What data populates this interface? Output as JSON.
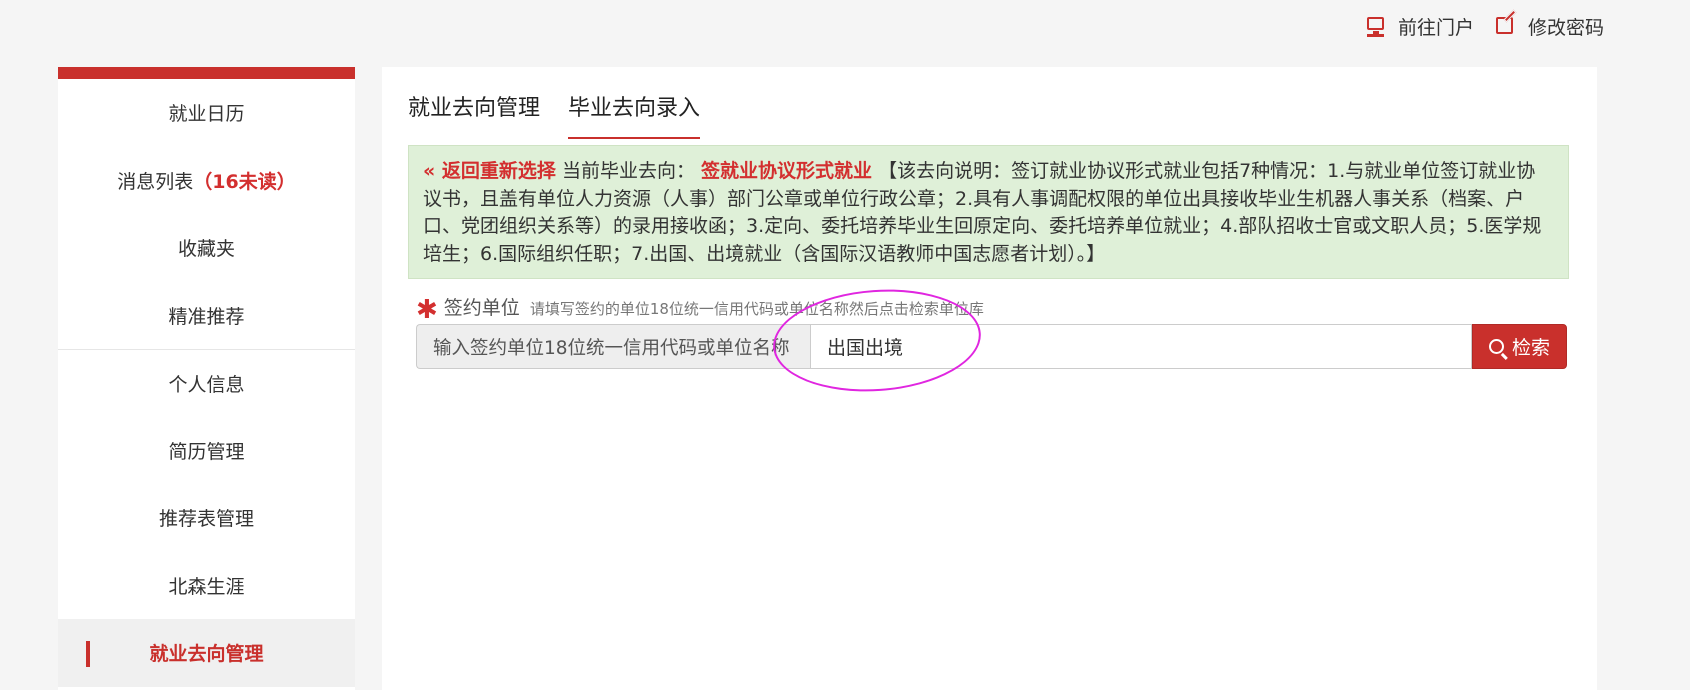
{
  "topbar": {
    "portal_label": "前往门户",
    "password_label": "修改密码",
    "accent_color": "#c9302c"
  },
  "sidebar": {
    "items": [
      {
        "label": "就业日历"
      },
      {
        "label": "消息列表",
        "badge": "（16未读）"
      },
      {
        "label": "收藏夹"
      },
      {
        "label": "精准推荐"
      },
      {
        "label": "个人信息"
      },
      {
        "label": "简历管理"
      },
      {
        "label": "推荐表管理"
      },
      {
        "label": "北森生涯"
      },
      {
        "label": "就业去向管理",
        "active": true
      }
    ]
  },
  "main": {
    "tabs": [
      {
        "label": "就业去向管理"
      },
      {
        "label": "毕业去向录入",
        "active": true
      }
    ],
    "notice": {
      "back_label": "« 返回重新选择",
      "current_prefix": "当前毕业去向：",
      "current_type": "签就业协议形式就业",
      "description": "【该去向说明：签订就业协议形式就业包括7种情况：1.与就业单位签订就业协议书，且盖有单位人力资源（人事）部门公章或单位行政公章；2.具有人事调配权限的单位出具接收毕业生机器人事关系（档案、户口、党团组织关系等）的录用接收函；3.定向、委托培养毕业生回原定向、委托培养单位就业；4.部队招收士官或文职人员；5.医学规培生；6.国际组织任职；7.出国、出境就业（含国际汉语教师中国志愿者计划）。】"
    },
    "field": {
      "required_mark": "✱",
      "label": "签约单位",
      "hint": "请填写签约的单位18位统一信用代码或单位名称然后点击检索单位库",
      "addon": "输入签约单位18位统一信用代码或单位名称",
      "value": "出国出境",
      "search_label": "检索"
    }
  }
}
